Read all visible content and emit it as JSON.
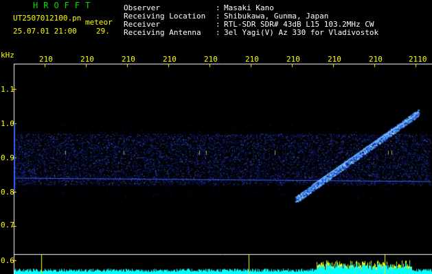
{
  "app": {
    "title": "HROFFT",
    "filename": "UT2507012100.pn",
    "mode": "meteor",
    "datetime": "25.07.01 21:00",
    "count": "29."
  },
  "meta": [
    {
      "label": "Observer",
      "value": "Masaki Kano"
    },
    {
      "label": "Receiving Location",
      "value": "Shibukawa, Gunma, Japan"
    },
    {
      "label": "Receiver",
      "value": "RTL-SDR SDR# 43dB L15 103.2MHz CW"
    },
    {
      "label": "Receiving Antenna",
      "value": "3el Yagi(V) Az 330 for Vladivostok"
    }
  ],
  "axes": {
    "y_unit": "kHz",
    "y_ticks": [
      "1.1",
      "1.0",
      "0.9",
      "0.8",
      "0.7",
      "0.6"
    ],
    "x_ticks": [
      "210",
      "210",
      "210",
      "210",
      "210",
      "210",
      "210",
      "210",
      "210",
      "2110"
    ]
  },
  "colors": {
    "background": "#000000",
    "label": "#ffff00",
    "title": "#00e000",
    "signal": "#3050ff",
    "level": "#00ffff"
  }
}
